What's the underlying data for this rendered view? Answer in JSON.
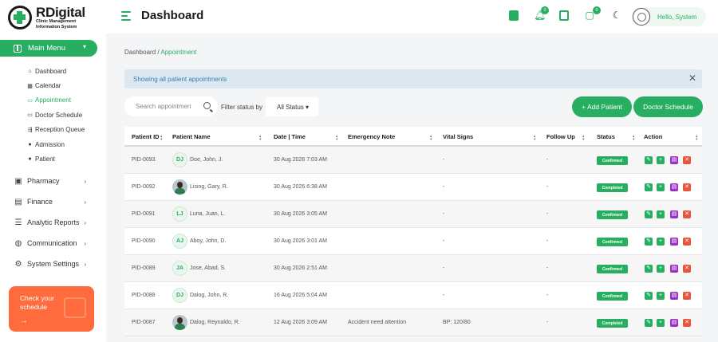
{
  "brand": {
    "title": "RDigital",
    "subtitle_line1": "Clinic Management",
    "subtitle_line2": "Information System"
  },
  "sidebar": {
    "main_menu": "Main Menu",
    "submenu": [
      {
        "label": "Dashboard",
        "icon": "home-icon"
      },
      {
        "label": "Calendar",
        "icon": "calendar-icon"
      },
      {
        "label": "Appointment",
        "icon": "calendar-check-icon",
        "active": true
      },
      {
        "label": "Doctor Schedule",
        "icon": "calendar-icon"
      },
      {
        "label": "Reception Queue",
        "icon": "queue-icon"
      },
      {
        "label": "Admission",
        "icon": "user-icon"
      },
      {
        "label": "Patient",
        "icon": "user-icon"
      }
    ],
    "nav": [
      {
        "label": "Pharmacy",
        "icon": "pharmacy-icon"
      },
      {
        "label": "Finance",
        "icon": "finance-icon"
      },
      {
        "label": "Analytic Reports",
        "icon": "sliders-icon"
      },
      {
        "label": "Communication",
        "icon": "globe-icon"
      },
      {
        "label": "System Settings",
        "icon": "gear-icon"
      }
    ],
    "promo": {
      "text": "Check your schedule",
      "arrow": "→"
    }
  },
  "header": {
    "title": "Dashboard",
    "notifications_count": "0",
    "messages_count": "0",
    "greeting": "Hello, System"
  },
  "breadcrumb": {
    "root": "Dashboard",
    "sep": "/",
    "current": "Appointment"
  },
  "alert": {
    "text": "Showing all patient appointments",
    "close": "✕"
  },
  "toolbar": {
    "search_placeholder": "Search appointments",
    "filter_label": "Filter status by",
    "status_value": "All Status",
    "add_patient": "+ Add Patient",
    "doctor_schedule": "Doctor Schedule"
  },
  "table": {
    "columns": [
      "Patient ID",
      "Patient Name",
      "Date | Time",
      "Emergency Note",
      "Vital Signs",
      "Follow Up",
      "Status",
      "Action"
    ],
    "rows": [
      {
        "id": "PID-0093",
        "initials": "DJ",
        "photo": false,
        "name": "Doe, John, J.",
        "datetime": "30 Aug 2026 7:03 AM",
        "note": "",
        "vitals": "-",
        "followup": "-",
        "status": "Confirmed"
      },
      {
        "id": "PID-0092",
        "initials": "",
        "photo": true,
        "name": "Lising, Gary, R.",
        "datetime": "30 Aug 2026 6:38 AM",
        "note": "",
        "vitals": "-",
        "followup": "-",
        "status": "Completed"
      },
      {
        "id": "PID-0091",
        "initials": "LJ",
        "photo": false,
        "name": "Luna, Juan, L.",
        "datetime": "30 Aug 2026 3:05 AM",
        "note": "",
        "vitals": "-",
        "followup": "-",
        "status": "Confirmed"
      },
      {
        "id": "PID-0090",
        "initials": "AJ",
        "photo": false,
        "name": "Aboy, John, D.",
        "datetime": "30 Aug 2026 3:01 AM",
        "note": "",
        "vitals": "-",
        "followup": "-",
        "status": "Confirmed"
      },
      {
        "id": "PID-0089",
        "initials": "JA",
        "photo": false,
        "name": "Jose, Abad, S.",
        "datetime": "30 Aug 2026 2:51 AM",
        "note": "",
        "vitals": "-",
        "followup": "-",
        "status": "Confirmed"
      },
      {
        "id": "PID-0088",
        "initials": "DJ",
        "photo": false,
        "name": "Dalog, John, R.",
        "datetime": "16 Aug 2026 5:04 AM",
        "note": "",
        "vitals": "-",
        "followup": "-",
        "status": "Confirmed"
      },
      {
        "id": "PID-0087",
        "initials": "",
        "photo": true,
        "name": "Dalog, Reynaldo, R.",
        "datetime": "12 Aug 2026 3:09 AM",
        "note": "Accident need attention",
        "vitals": "BP: 120/80",
        "followup": "-",
        "status": "Completed"
      }
    ]
  },
  "colors": {
    "accent": "#27ae60",
    "promo": "#ff6b3d",
    "print": "#9b30c8",
    "delete": "#e8553f",
    "alert_bg": "#dde9f2"
  }
}
